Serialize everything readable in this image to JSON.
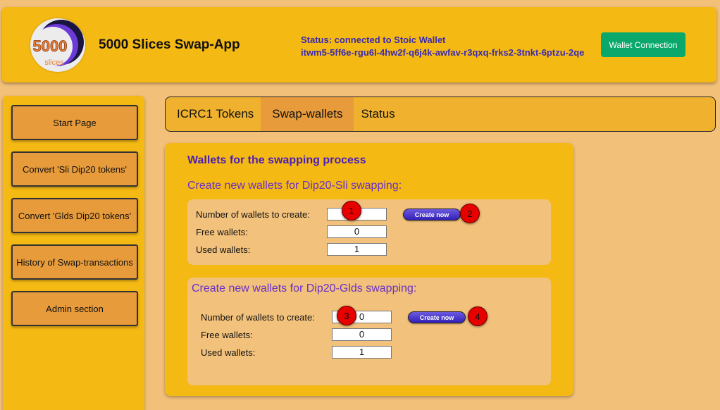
{
  "header": {
    "logo_text": "5000",
    "logo_subtext": "slices",
    "app_title": "5000 Slices Swap-App",
    "status": "Status: connected to Stoic Wallet",
    "principal": "itwm5-5ff6e-rgu6l-4hw2f-q6j4k-awfav-r3qxq-frks2-3tnkt-6ptzu-2qe",
    "wallet_button": "Wallet Connection"
  },
  "sidebar": {
    "items": [
      {
        "label": "Start Page"
      },
      {
        "label": "Convert 'Sli Dip20 tokens'"
      },
      {
        "label": "Convert 'Glds Dip20 tokens'"
      },
      {
        "label": "History of Swap-transactions"
      },
      {
        "label": "Admin section"
      }
    ]
  },
  "tabs": [
    {
      "label": "ICRC1 Tokens"
    },
    {
      "label": "Swap-wallets"
    },
    {
      "label": "Status"
    }
  ],
  "panel": {
    "title": "Wallets for the swapping process",
    "sli": {
      "title": "Create new wallets for Dip20-Sli swapping:",
      "label_create": "Number of wallets to create:",
      "label_free": "Free wallets:",
      "label_used": "Used wallets:",
      "value_create": "0",
      "value_free": "0",
      "value_used": "1",
      "button": "Create now"
    },
    "glds": {
      "title": "Create new wallets for Dip20-Glds swapping:",
      "label_create": "Number of wallets to create:",
      "label_free": "Free wallets:",
      "label_used": "Used wallets:",
      "value_create": "0",
      "value_free": "0",
      "value_used": "1",
      "button": "Create now"
    }
  },
  "markers": [
    "1",
    "2",
    "3",
    "4"
  ],
  "colors": {
    "background": "#f3c07a",
    "header": "#f5b914",
    "accent_button": "#0aa86a",
    "status_text": "#3a2bb0",
    "section_title": "#6a30c8",
    "marker": "#e60000"
  }
}
